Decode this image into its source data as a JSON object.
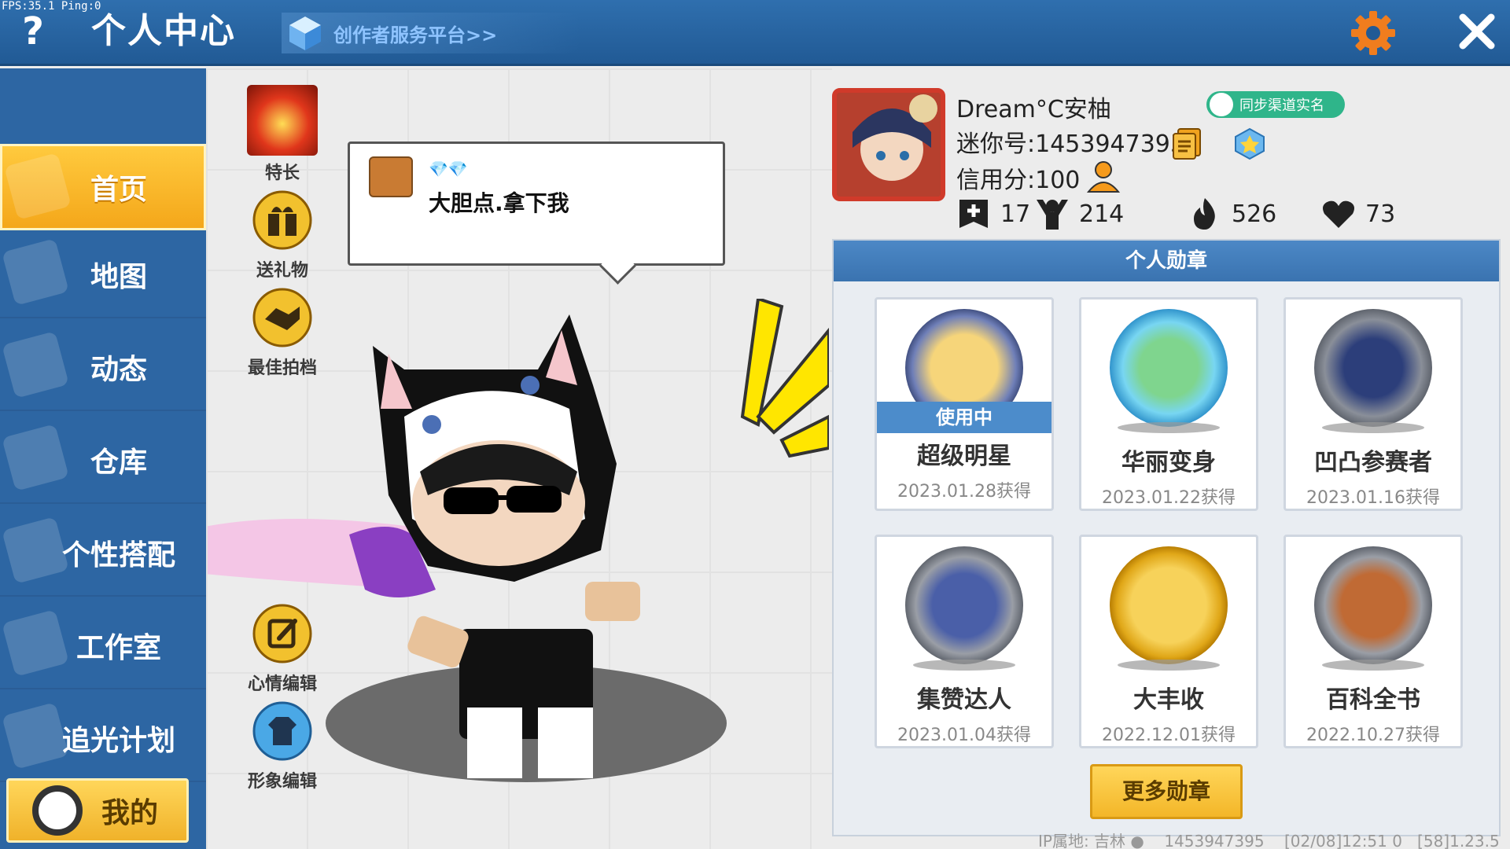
{
  "topbar": {
    "fps": "FPS:35.1 Ping:0",
    "help": "?",
    "title": "个人中心",
    "creator_link": "创作者服务平台>>"
  },
  "sidebar": {
    "items": [
      {
        "label": "首页",
        "active": true
      },
      {
        "label": "地图",
        "active": false
      },
      {
        "label": "动态",
        "active": false
      },
      {
        "label": "仓库",
        "active": false
      },
      {
        "label": "个性搭配",
        "active": false
      },
      {
        "label": "工作室",
        "active": false
      },
      {
        "label": "追光计划",
        "active": false
      }
    ],
    "me_label": "我的"
  },
  "stage": {
    "actions": {
      "specialty": "特长",
      "gift": "送礼物",
      "best_partner": "最佳拍档",
      "mood_edit": "心情编辑",
      "avatar_edit": "形象编辑"
    },
    "speech": "大胆点.拿下我"
  },
  "profile": {
    "nickname": "Dream°C安柚",
    "realname_badge": "同步渠道实名",
    "mini_id": "迷你号:1453947395",
    "credit": "信用分:100",
    "stats": {
      "followers": "17",
      "fans": "214",
      "popularity": "526",
      "likes": "73"
    }
  },
  "badges": {
    "title": "个人勋章",
    "in_use_label": "使用中",
    "items": [
      {
        "name": "超级明星",
        "date": "2023.01.28获得",
        "in_use": true
      },
      {
        "name": "华丽变身",
        "date": "2023.01.22获得",
        "in_use": false
      },
      {
        "name": "凹凸参赛者",
        "date": "2023.01.16获得",
        "in_use": false
      },
      {
        "name": "集赞达人",
        "date": "2023.01.04获得",
        "in_use": false
      },
      {
        "name": "大丰收",
        "date": "2022.12.01获得",
        "in_use": false
      },
      {
        "name": "百科全书",
        "date": "2022.10.27获得",
        "in_use": false
      }
    ],
    "more": "更多勋章"
  },
  "footer": {
    "ip": "IP属地: 吉林",
    "id": "1453947395",
    "time": "[02/08]12:51 0",
    "version": "[58]1.23.5"
  },
  "colors": {
    "topbar": "#2f6fae",
    "sidebar": "#2d66a3",
    "active": "#f4a71a",
    "accent_orange": "#f07d1e"
  }
}
